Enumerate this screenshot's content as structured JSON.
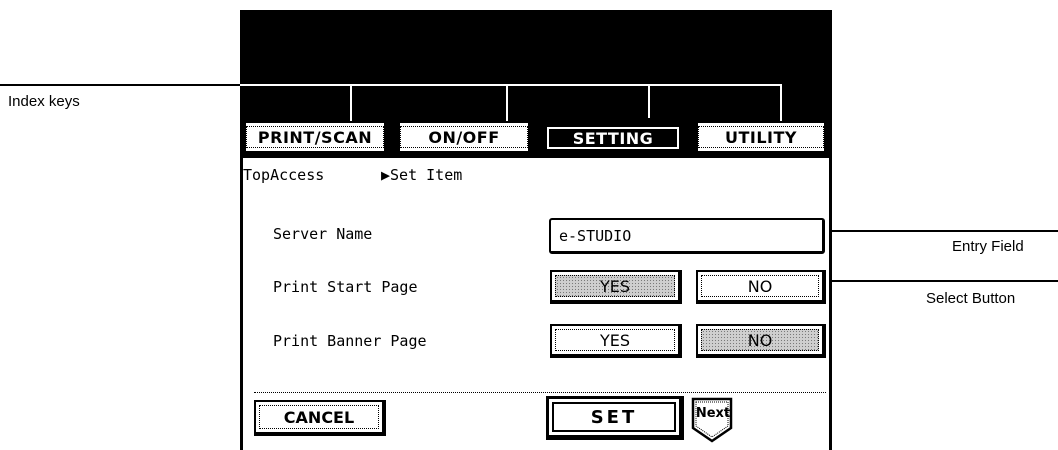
{
  "callouts": {
    "index_keys": "Index keys",
    "entry_field": "Entry Field",
    "select_button": "Select Button"
  },
  "tabs": [
    {
      "label": "PRINT/SCAN",
      "active": false
    },
    {
      "label": "ON/OFF",
      "active": false
    },
    {
      "label": "SETTING",
      "active": true
    },
    {
      "label": "UTILITY",
      "active": false
    }
  ],
  "breadcrumb": {
    "left": "TopAccess",
    "right": "▶Set Item"
  },
  "settings": {
    "server_name": {
      "label": "Server Name",
      "value": "e-STUDIO"
    },
    "print_start_page": {
      "label": "Print Start Page",
      "yes": "YES",
      "no": "NO",
      "selected": "YES"
    },
    "print_banner_page": {
      "label": "Print Banner Page",
      "yes": "YES",
      "no": "NO",
      "selected": "NO"
    }
  },
  "footer": {
    "cancel": "CANCEL",
    "set": "SET",
    "next": "Next"
  }
}
